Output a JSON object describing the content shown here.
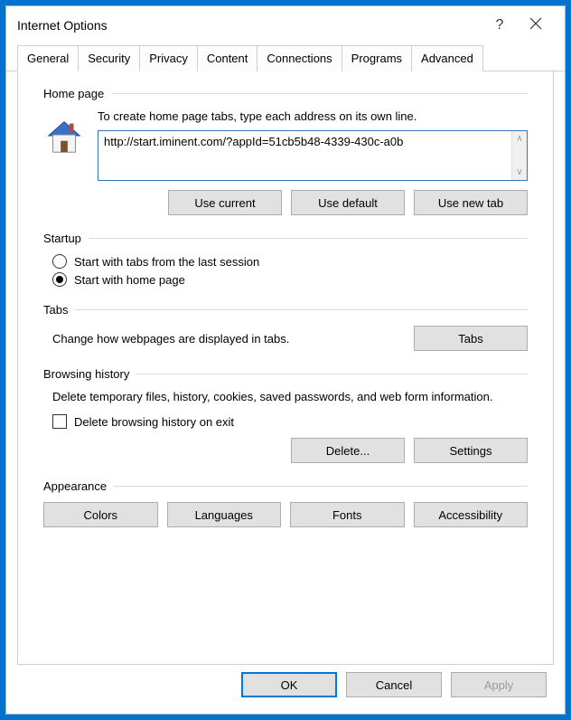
{
  "window": {
    "title": "Internet Options"
  },
  "tabs": {
    "items": [
      "General",
      "Security",
      "Privacy",
      "Content",
      "Connections",
      "Programs",
      "Advanced"
    ],
    "active": 0
  },
  "homepage": {
    "section_label": "Home page",
    "description": "To create home page tabs, type each address on its own line.",
    "url": "http://start.iminent.com/?appId=51cb5b48-4339-430c-a0b",
    "btn_current": "Use current",
    "btn_default": "Use default",
    "btn_newtab": "Use new tab"
  },
  "startup": {
    "section_label": "Startup",
    "option_last": "Start with tabs from the last session",
    "option_home": "Start with home page"
  },
  "tabsSection": {
    "section_label": "Tabs",
    "description": "Change how webpages are displayed in tabs.",
    "btn": "Tabs"
  },
  "history": {
    "section_label": "Browsing history",
    "description": "Delete temporary files, history, cookies, saved passwords, and web form information.",
    "check_label": "Delete browsing history on exit",
    "btn_delete": "Delete...",
    "btn_settings": "Settings"
  },
  "appearance": {
    "section_label": "Appearance",
    "btn_colors": "Colors",
    "btn_lang": "Languages",
    "btn_fonts": "Fonts",
    "btn_access": "Accessibility"
  },
  "footer": {
    "ok": "OK",
    "cancel": "Cancel",
    "apply": "Apply"
  }
}
